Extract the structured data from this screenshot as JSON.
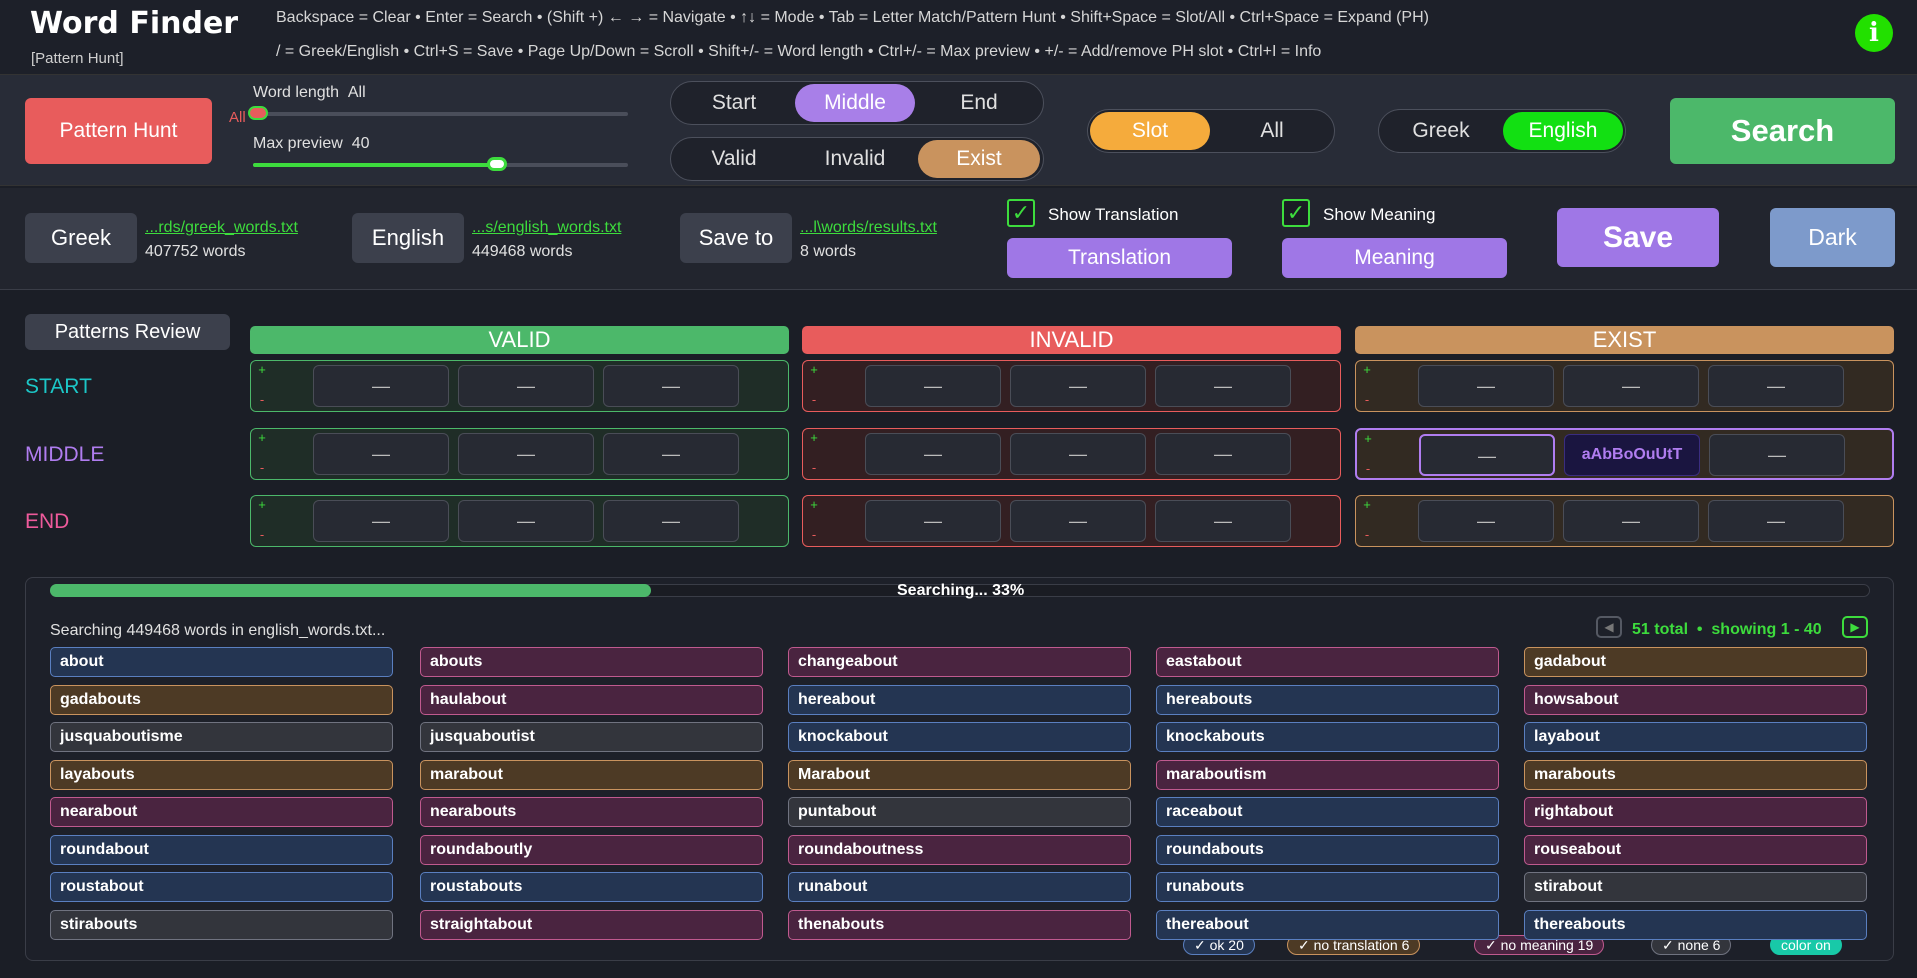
{
  "header": {
    "title": "Word Finder",
    "subtitle": "[Pattern Hunt]",
    "shortcuts_line1": "Backspace = Clear  •  Enter = Search  •  (Shift +) ← → = Navigate  •  ↑↓ = Mode  •  Tab = Letter Match/Pattern Hunt  •  Shift+Space = Slot/All  •  Ctrl+Space = Expand (PH)",
    "shortcuts_line2": "/ = Greek/English  •  Ctrl+S = Save  •  Page Up/Down = Scroll  •  Shift+/- = Word length  •  Ctrl+/- = Max preview  •  +/- = Add/remove PH slot  •  Ctrl+I = Info",
    "info_label": "i"
  },
  "controls": {
    "mode_button": "Pattern Hunt",
    "word_length_label": "Word length",
    "word_length_value": "All",
    "word_length_marker": "All",
    "max_preview_label": "Max preview",
    "max_preview_value": "40",
    "max_preview_fraction": 0.65,
    "position_options": [
      "Start",
      "Middle",
      "End"
    ],
    "position_selected": "Middle",
    "validity_options": [
      "Valid",
      "Invalid",
      "Exist"
    ],
    "validity_selected": "Exist",
    "scope_options": [
      "Slot",
      "All"
    ],
    "scope_selected": "Slot",
    "language_options": [
      "Greek",
      "English"
    ],
    "language_selected": "English",
    "search_button": "Search"
  },
  "files": {
    "greek_button": "Greek",
    "greek_path": "...rds/greek_words.txt",
    "greek_count": "407752 words",
    "english_button": "English",
    "english_path": "...s/english_words.txt",
    "english_count": "449468 words",
    "save_to_button": "Save to",
    "save_path": "...l\\words/results.txt",
    "save_count": "8 words",
    "show_translation_label": "Show Translation",
    "show_translation_checked": true,
    "translation_button": "Translation",
    "show_meaning_label": "Show Meaning",
    "show_meaning_checked": true,
    "meaning_button": "Meaning",
    "save_button": "Save",
    "dark_button": "Dark"
  },
  "patterns": {
    "review_button": "Patterns Review",
    "columns": [
      "VALID",
      "INVALID",
      "EXIST"
    ],
    "rows": [
      "START",
      "MIDDLE",
      "END"
    ],
    "empty_slot": "—",
    "slot_icon": "≈",
    "add_symbol": "+",
    "remove_symbol": "-",
    "filled_slot_text": "aAbBoOuUtT",
    "colors": {
      "valid": "#4cb86a",
      "invalid": "#e85c5c",
      "exist": "#c9935e",
      "start": "#1cc7c7",
      "middle": "#b07df0",
      "end": "#ee5a9b"
    }
  },
  "results": {
    "progress_fraction": 0.33,
    "progress_text": "Searching... 33%",
    "status_text": "Searching 449468 words in english_words.txt...",
    "total_text": "51 total",
    "showing_text": "showing 1 - 40",
    "bullet": "•",
    "words": [
      {
        "text": "about",
        "color": "blue"
      },
      {
        "text": "abouts",
        "color": "pink"
      },
      {
        "text": "changeabout",
        "color": "pink"
      },
      {
        "text": "eastabout",
        "color": "pink"
      },
      {
        "text": "gadabout",
        "color": "orange"
      },
      {
        "text": "gadabouts",
        "color": "orange"
      },
      {
        "text": "haulabout",
        "color": "pink"
      },
      {
        "text": "hereabout",
        "color": "blue"
      },
      {
        "text": "hereabouts",
        "color": "blue"
      },
      {
        "text": "howsabout",
        "color": "pink"
      },
      {
        "text": "jusquaboutisme",
        "color": "gray"
      },
      {
        "text": "jusquaboutist",
        "color": "gray"
      },
      {
        "text": "knockabout",
        "color": "blue"
      },
      {
        "text": "knockabouts",
        "color": "blue"
      },
      {
        "text": "layabout",
        "color": "blue"
      },
      {
        "text": "layabouts",
        "color": "orange"
      },
      {
        "text": "marabout",
        "color": "orange"
      },
      {
        "text": "Marabout",
        "color": "orange"
      },
      {
        "text": "maraboutism",
        "color": "pink"
      },
      {
        "text": "marabouts",
        "color": "orange"
      },
      {
        "text": "nearabout",
        "color": "pink"
      },
      {
        "text": "nearabouts",
        "color": "pink"
      },
      {
        "text": "puntabout",
        "color": "gray"
      },
      {
        "text": "raceabout",
        "color": "blue"
      },
      {
        "text": "rightabout",
        "color": "pink"
      },
      {
        "text": "roundabout",
        "color": "blue"
      },
      {
        "text": "roundaboutly",
        "color": "pink"
      },
      {
        "text": "roundaboutness",
        "color": "pink"
      },
      {
        "text": "roundabouts",
        "color": "blue"
      },
      {
        "text": "rouseabout",
        "color": "pink"
      },
      {
        "text": "roustabout",
        "color": "blue"
      },
      {
        "text": "roustabouts",
        "color": "blue"
      },
      {
        "text": "runabout",
        "color": "blue"
      },
      {
        "text": "runabouts",
        "color": "blue"
      },
      {
        "text": "stirabout",
        "color": "gray"
      },
      {
        "text": "stirabouts",
        "color": "gray"
      },
      {
        "text": "straightabout",
        "color": "pink"
      },
      {
        "text": "thenabouts",
        "color": "pink"
      },
      {
        "text": "thereabout",
        "color": "blue"
      },
      {
        "text": "thereabouts",
        "color": "blue"
      }
    ],
    "chip_colors": {
      "blue": {
        "bg": "#243552",
        "border": "#5a7fc0"
      },
      "pink": {
        "bg": "#4a2440",
        "border": "#c05a8f"
      },
      "orange": {
        "bg": "#4d3a25",
        "border": "#c9935e"
      },
      "gray": {
        "bg": "#33353c",
        "border": "#707380"
      }
    },
    "filters": [
      {
        "label": "ok 20",
        "color": "blue"
      },
      {
        "label": "no translation 6",
        "color": "orange"
      },
      {
        "label": "no meaning 19",
        "color": "pink"
      },
      {
        "label": "none 6",
        "color": "gray"
      }
    ],
    "color_toggle": "color on"
  }
}
